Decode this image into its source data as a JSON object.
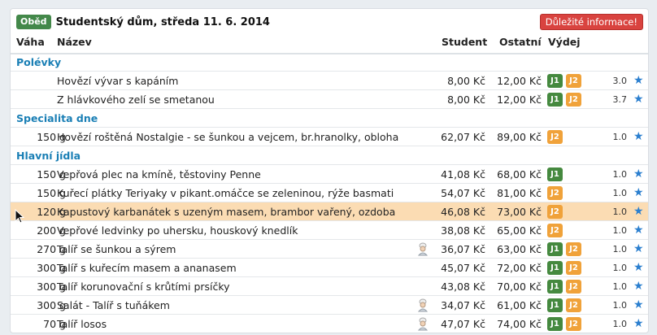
{
  "header": {
    "meal_label": "Oběd",
    "title": "Studentský dům, středa 11. 6. 2014",
    "alert_button": "Důležité informace!"
  },
  "columns": {
    "weight": "Váha",
    "name": "Název",
    "student": "Student",
    "other": "Ostatní",
    "dispense": "Výdej"
  },
  "rows": [
    {
      "type": "category",
      "name": "Polévky"
    },
    {
      "type": "item",
      "weight": "",
      "name": "Hovězí vývar s kapáním",
      "student": "8,00 Kč",
      "other": "12,00 Kč",
      "badges": [
        "J1",
        "J2"
      ],
      "rating": "3.0",
      "chef": false,
      "highlight": false
    },
    {
      "type": "item",
      "weight": "",
      "name": "Z hlávkového zelí se smetanou",
      "student": "8,00 Kč",
      "other": "12,00 Kč",
      "badges": [
        "J1",
        "J2"
      ],
      "rating": "3.7",
      "chef": false,
      "highlight": false
    },
    {
      "type": "category",
      "name": "Specialita dne"
    },
    {
      "type": "item",
      "weight": "150 g",
      "name": "Hovězí roštěná Nostalgie - se šunkou a vejcem, br.hranolky, obloha",
      "student": "62,07 Kč",
      "other": "89,00 Kč",
      "badges": [
        "J2"
      ],
      "rating": "1.0",
      "chef": false,
      "highlight": false
    },
    {
      "type": "category",
      "name": "Hlavní jídla"
    },
    {
      "type": "item",
      "weight": "150 g",
      "name": "Vepřová plec na kmíně, těstoviny Penne",
      "student": "41,08 Kč",
      "other": "68,00 Kč",
      "badges": [
        "J1"
      ],
      "rating": "1.0",
      "chef": false,
      "highlight": false
    },
    {
      "type": "item",
      "weight": "150 g",
      "name": "Kuřecí plátky Teriyaky v pikant.omáčce se zeleninou, rýže basmati",
      "student": "54,07 Kč",
      "other": "81,00 Kč",
      "badges": [
        "J2"
      ],
      "rating": "1.0",
      "chef": false,
      "highlight": false
    },
    {
      "type": "item",
      "weight": "120 g",
      "name": "Kapustový karbanátek s uzeným masem, brambor vařený, ozdoba",
      "student": "46,08 Kč",
      "other": "73,00 Kč",
      "badges": [
        "J2"
      ],
      "rating": "1.0",
      "chef": false,
      "highlight": true
    },
    {
      "type": "item",
      "weight": "200 g",
      "name": "Vepřové ledvinky po uhersku, houskový knedlík",
      "student": "38,08 Kč",
      "other": "65,00 Kč",
      "badges": [
        "J2"
      ],
      "rating": "1.0",
      "chef": false,
      "highlight": false
    },
    {
      "type": "item",
      "weight": "270 g",
      "name": "Talíř se šunkou a sýrem",
      "student": "36,07 Kč",
      "other": "63,00 Kč",
      "badges": [
        "J1",
        "J2"
      ],
      "rating": "1.0",
      "chef": true,
      "highlight": false
    },
    {
      "type": "item",
      "weight": "300 g",
      "name": "Talíř s kuřecím masem a ananasem",
      "student": "45,07 Kč",
      "other": "72,00 Kč",
      "badges": [
        "J1",
        "J2"
      ],
      "rating": "1.0",
      "chef": false,
      "highlight": false
    },
    {
      "type": "item",
      "weight": "300 g",
      "name": "Talíř korunovační s krůtími prsíčky",
      "student": "43,08 Kč",
      "other": "70,00 Kč",
      "badges": [
        "J1",
        "J2"
      ],
      "rating": "1.0",
      "chef": false,
      "highlight": false
    },
    {
      "type": "item",
      "weight": "300 g",
      "name": "Salát - Talíř s tuňákem",
      "student": "34,07 Kč",
      "other": "61,00 Kč",
      "badges": [
        "J1",
        "J2"
      ],
      "rating": "1.0",
      "chef": true,
      "highlight": false
    },
    {
      "type": "item",
      "weight": "70 g",
      "name": "Talíř losos",
      "student": "47,07 Kč",
      "other": "74,00 Kč",
      "badges": [
        "J1",
        "J2"
      ],
      "rating": "1.0",
      "chef": true,
      "highlight": false
    }
  ],
  "icons": {
    "star": "star-icon",
    "chef": "chef-icon",
    "cursor": "mouse-pointer-icon"
  },
  "colors": {
    "meal_label": "#43884a",
    "alert": "#d9433f",
    "category": "#1a7fb5",
    "badge_j1": "#45893f",
    "badge_j2": "#f0a23a",
    "highlight_row": "#fbdcb3",
    "star": "#2b7fcf"
  }
}
